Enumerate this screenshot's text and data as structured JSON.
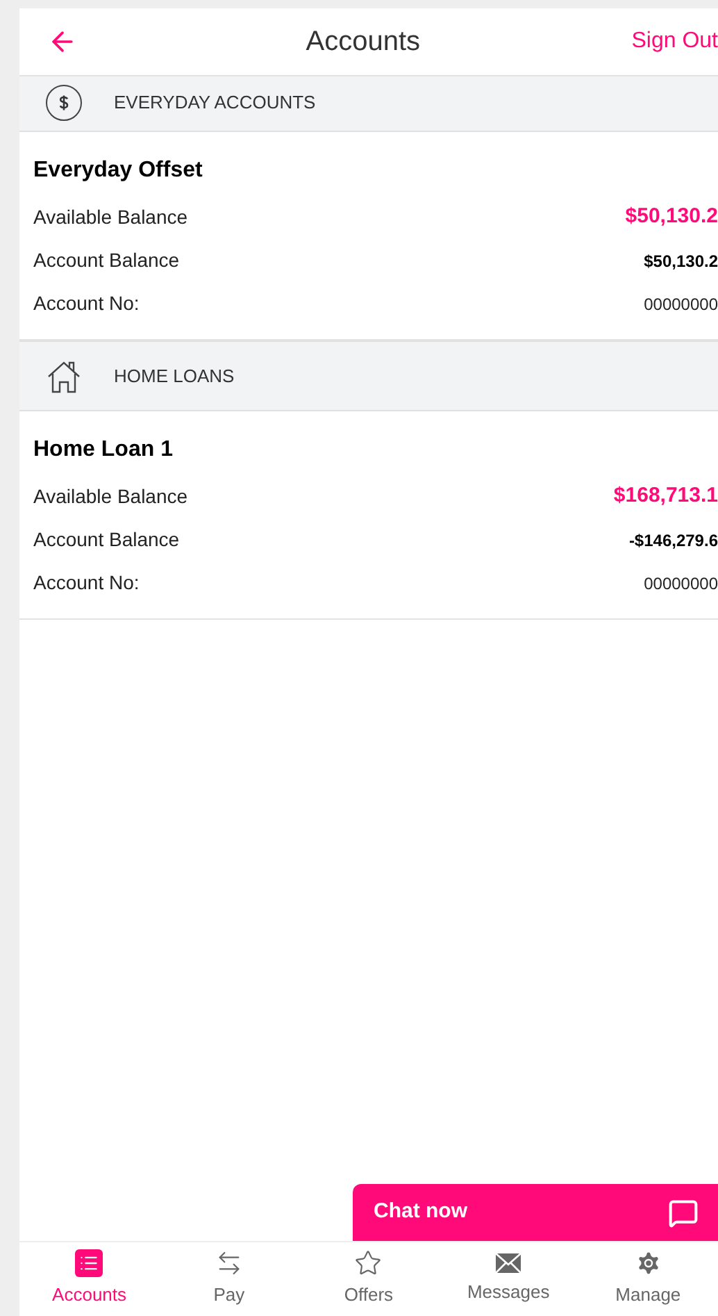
{
  "header": {
    "title": "Accounts",
    "action": "Sign Out"
  },
  "sections": [
    {
      "kind": "dollar",
      "title": "EVERYDAY ACCOUNTS",
      "account": {
        "name": "Everyday Offset",
        "rows": [
          {
            "label": "Available Balance",
            "value": "$50,130.2",
            "kind": "highlight"
          },
          {
            "label": "Account Balance",
            "value": "$50,130.2",
            "kind": "bold"
          },
          {
            "label": "Account No:",
            "value": "00000000",
            "kind": "plain"
          }
        ]
      }
    },
    {
      "kind": "house",
      "title": "HOME LOANS",
      "account": {
        "name": "Home Loan 1",
        "rows": [
          {
            "label": "Available Balance",
            "value": "$168,713.1",
            "kind": "highlight"
          },
          {
            "label": "Account Balance",
            "value": "-$146,279.6",
            "kind": "bold"
          },
          {
            "label": "Account No:",
            "value": "00000000",
            "kind": "plain"
          }
        ]
      }
    }
  ],
  "chat": {
    "label": "Chat now"
  },
  "nav": [
    {
      "kind": "list",
      "label": "Accounts",
      "selected": true
    },
    {
      "kind": "arrows",
      "label": "Pay",
      "selected": false
    },
    {
      "kind": "star",
      "label": "Offers",
      "selected": false
    },
    {
      "kind": "mail",
      "label": "Messages",
      "selected": false
    },
    {
      "kind": "gear",
      "label": "Manage",
      "selected": false
    }
  ]
}
